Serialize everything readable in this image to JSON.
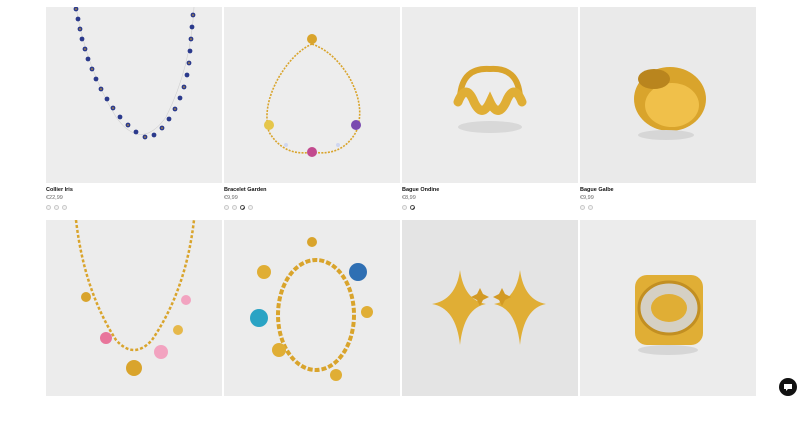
{
  "products": [
    {
      "name": "Collier Iris",
      "price": "€22,99",
      "swatches": 3,
      "selected": -1,
      "bg": "#ededed"
    },
    {
      "name": "Bracelet Garden",
      "price": "€9,99",
      "swatches": 4,
      "selected": 2,
      "bg": "#ededed"
    },
    {
      "name": "Bague Ondine",
      "price": "€8,99",
      "swatches": 2,
      "selected": 1,
      "bg": "#ececec"
    },
    {
      "name": "Bague Galbe",
      "price": "€9,99",
      "swatches": 2,
      "selected": -1,
      "bg": "#eaeaea"
    },
    {
      "name": "",
      "price": "",
      "swatches": 0,
      "selected": -1,
      "bg": "#ececec"
    },
    {
      "name": "",
      "price": "",
      "swatches": 0,
      "selected": -1,
      "bg": "#ececec"
    },
    {
      "name": "",
      "price": "",
      "swatches": 0,
      "selected": -1,
      "bg": "#e4e4e4"
    },
    {
      "name": "",
      "price": "",
      "swatches": 0,
      "selected": -1,
      "bg": "#ececec"
    }
  ],
  "colors": {
    "gold": "#d9a42c",
    "navy": "#2b3a8c",
    "chat_bg": "#111111"
  },
  "icons": {
    "chat": "chat-bubble-icon"
  }
}
